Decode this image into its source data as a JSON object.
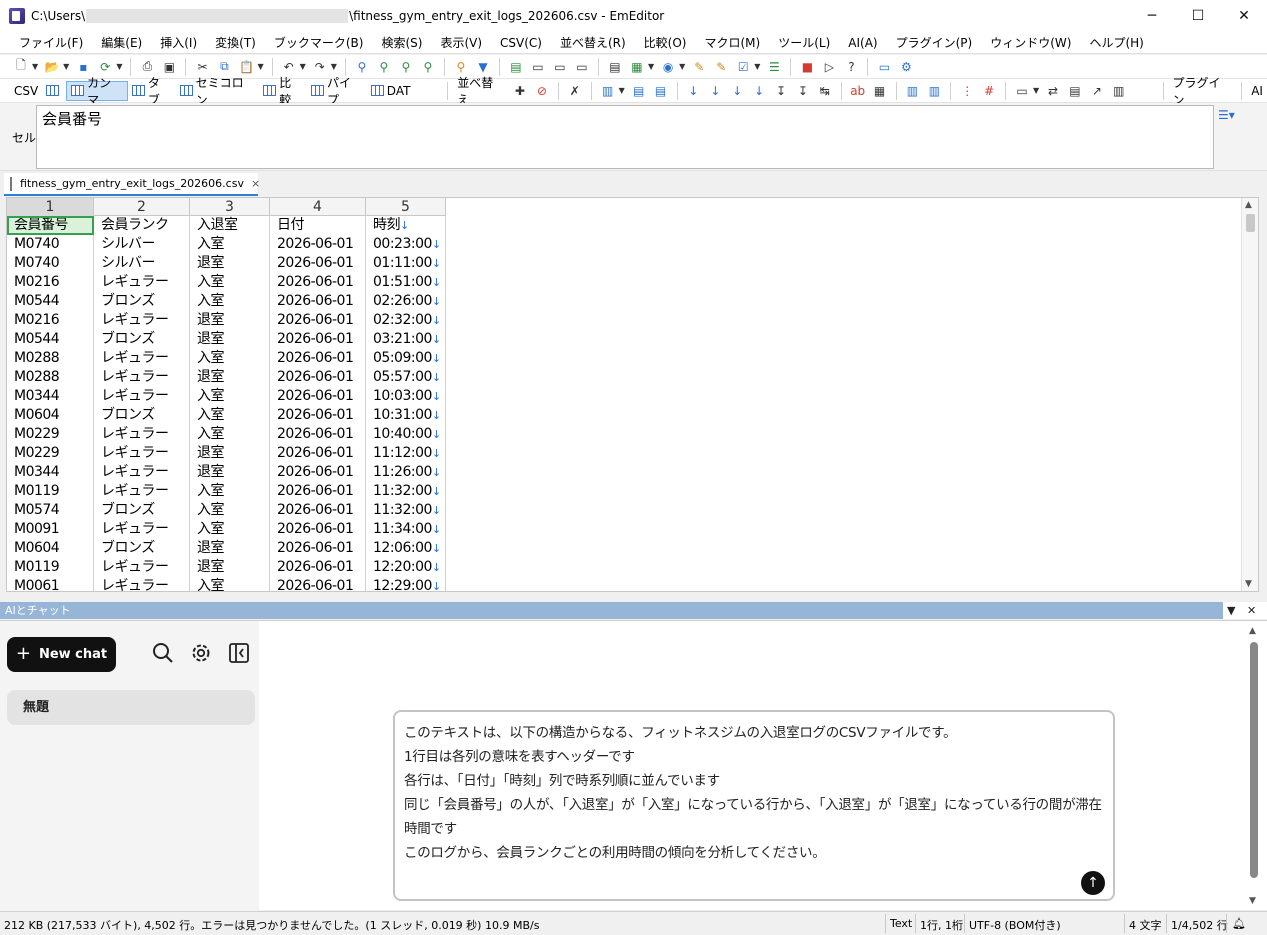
{
  "window": {
    "title_prefix": "C:\\Users\\",
    "title_suffix": "\\fitness_gym_entry_exit_logs_202606.csv - EmEditor",
    "min_glyph": "─",
    "max_glyph": "☐",
    "close_glyph": "✕"
  },
  "menu": [
    "ファイル(F)",
    "編集(E)",
    "挿入(I)",
    "変換(T)",
    "ブックマーク(B)",
    "検索(S)",
    "表示(V)",
    "CSV(C)",
    "並べ替え(R)",
    "比較(O)",
    "マクロ(M)",
    "ツール(L)",
    "AI(A)",
    "プラグイン(P)",
    "ウィンドウ(W)",
    "ヘルプ(H)"
  ],
  "csv_toolbar": {
    "csv": "CSV",
    "comma": "カンマ",
    "tab": "タブ",
    "semicolon": "セミコロン",
    "compare": "比較",
    "pipe": "パイプ",
    "dat": "DAT",
    "sort": "並べ替え",
    "plugin": "プラグイン",
    "ai": "AI"
  },
  "cell_bar": {
    "label": "セル",
    "value": "会員番号"
  },
  "file_tab": {
    "name": "fitness_gym_entry_exit_logs_202606.csv",
    "close": "×"
  },
  "grid": {
    "column_numbers": [
      "1",
      "2",
      "3",
      "4",
      "5"
    ],
    "eol": "↓",
    "rows": [
      [
        "会員番号",
        "会員ランク",
        "入退室",
        "日付",
        "時刻"
      ],
      [
        "M0740",
        "シルバー",
        "入室",
        "2026-06-01",
        "00:23:00"
      ],
      [
        "M0740",
        "シルバー",
        "退室",
        "2026-06-01",
        "01:11:00"
      ],
      [
        "M0216",
        "レギュラー",
        "入室",
        "2026-06-01",
        "01:51:00"
      ],
      [
        "M0544",
        "ブロンズ",
        "入室",
        "2026-06-01",
        "02:26:00"
      ],
      [
        "M0216",
        "レギュラー",
        "退室",
        "2026-06-01",
        "02:32:00"
      ],
      [
        "M0544",
        "ブロンズ",
        "退室",
        "2026-06-01",
        "03:21:00"
      ],
      [
        "M0288",
        "レギュラー",
        "入室",
        "2026-06-01",
        "05:09:00"
      ],
      [
        "M0288",
        "レギュラー",
        "退室",
        "2026-06-01",
        "05:57:00"
      ],
      [
        "M0344",
        "レギュラー",
        "入室",
        "2026-06-01",
        "10:03:00"
      ],
      [
        "M0604",
        "ブロンズ",
        "入室",
        "2026-06-01",
        "10:31:00"
      ],
      [
        "M0229",
        "レギュラー",
        "入室",
        "2026-06-01",
        "10:40:00"
      ],
      [
        "M0229",
        "レギュラー",
        "退室",
        "2026-06-01",
        "11:12:00"
      ],
      [
        "M0344",
        "レギュラー",
        "退室",
        "2026-06-01",
        "11:26:00"
      ],
      [
        "M0119",
        "レギュラー",
        "入室",
        "2026-06-01",
        "11:32:00"
      ],
      [
        "M0574",
        "ブロンズ",
        "入室",
        "2026-06-01",
        "11:32:00"
      ],
      [
        "M0091",
        "レギュラー",
        "入室",
        "2026-06-01",
        "11:34:00"
      ],
      [
        "M0604",
        "ブロンズ",
        "退室",
        "2026-06-01",
        "12:06:00"
      ],
      [
        "M0119",
        "レギュラー",
        "退室",
        "2026-06-01",
        "12:20:00"
      ],
      [
        "M0061",
        "レギュラー",
        "入室",
        "2026-06-01",
        "12:29:00"
      ]
    ]
  },
  "ai_panel": {
    "header": "AIとチャット",
    "new_chat": "New chat",
    "conversation": "無題",
    "prompt_lines": [
      "このテキストは、以下の構造からなる、フィットネスジムの入退室ログのCSVファイルです。",
      "1行目は各列の意味を表すヘッダーです",
      "各行は、「日付」「時刻」列で時系列順に並んでいます",
      "同じ「会員番号」の人が、「入退室」が「入室」になっている行から、「入退室」が「退室」になっている行の間が滞在",
      "時間です",
      "このログから、会員ランクごとの利用時間の傾向を分析してください。"
    ]
  },
  "status": {
    "info": "212 KB (217,533 バイト), 4,502 行。エラーは見つかりませんでした。(1 スレッド, 0.019 秒) 10.9 MB/s",
    "mode": "Text",
    "position": "1行, 1桁",
    "encoding": "UTF-8 (BOM付き)",
    "chars": "4 文字",
    "lines": "1/4,502 行"
  },
  "colors": {
    "accent": "#2f7fd8",
    "selection_green": "#35a150",
    "ai_header": "#97b6d7"
  }
}
